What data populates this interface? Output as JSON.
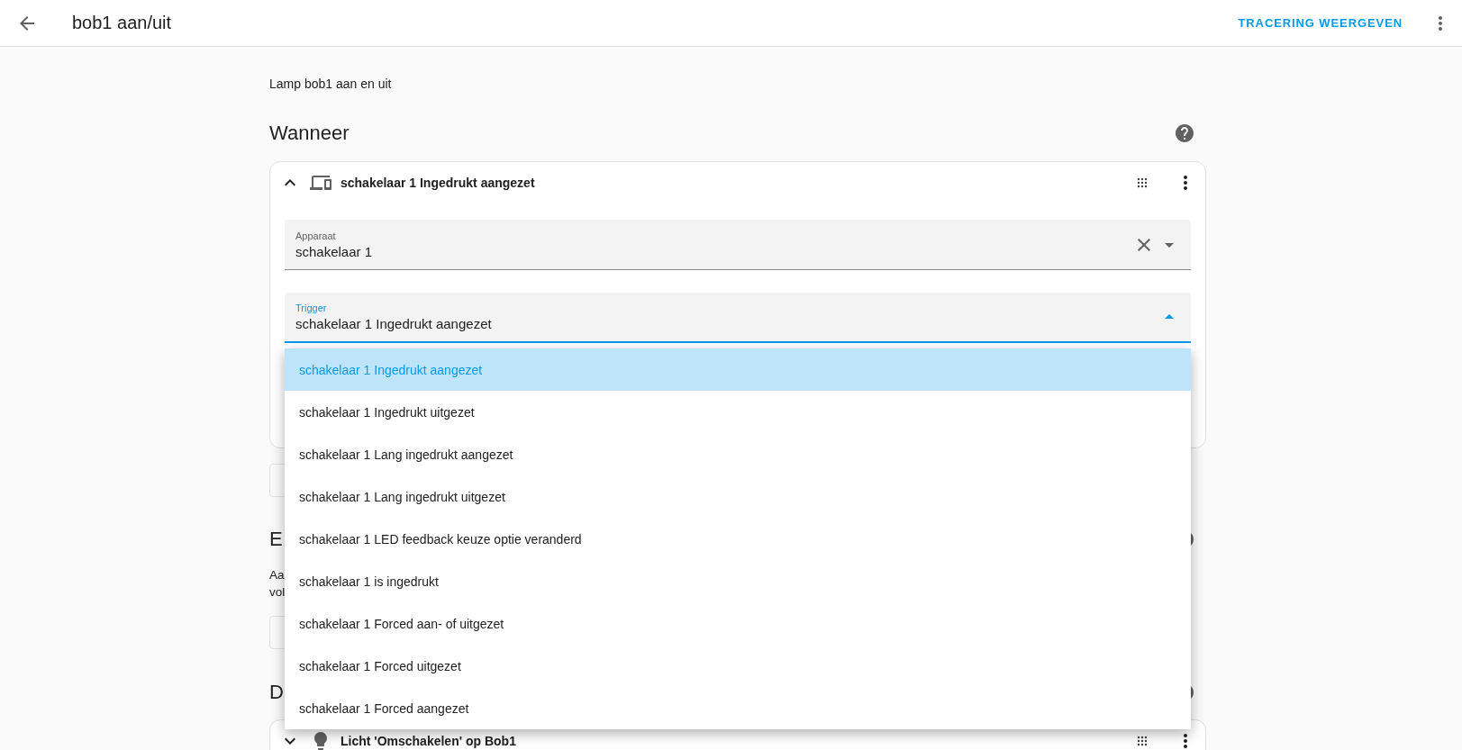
{
  "header": {
    "title": "bob1 aan/uit",
    "action": "TRACERING WEERGEVEN"
  },
  "description": "Lamp bob1 aan en uit",
  "sections": [
    {
      "heading": "Wanneer",
      "cards": [
        {
          "kind": "device",
          "title": "schakelaar 1 Ingedrukt aangezet",
          "expanded": true,
          "fields": [
            {
              "label": "Apparaat",
              "value": "schakelaar 1",
              "clearable": true,
              "open": false
            },
            {
              "label": "Trigger",
              "value": "schakelaar 1 Ingedrukt aangezet",
              "clearable": false,
              "open": true,
              "options": [
                {
                  "label": "schakelaar 1 Ingedrukt aangezet",
                  "selected": true
                },
                {
                  "label": "schakelaar 1 Ingedrukt uitgezet",
                  "selected": false
                },
                {
                  "label": "schakelaar 1 Lang ingedrukt aangezet",
                  "selected": false
                },
                {
                  "label": "schakelaar 1 Lang ingedrukt uitgezet",
                  "selected": false
                },
                {
                  "label": "schakelaar 1 LED feedback keuze optie veranderd",
                  "selected": false
                },
                {
                  "label": "schakelaar 1 is ingedrukt",
                  "selected": false
                },
                {
                  "label": "schakelaar 1 Forced aan- of uitgezet",
                  "selected": false
                },
                {
                  "label": "schakelaar 1 Forced uitgezet",
                  "selected": false
                },
                {
                  "label": "schakelaar 1 Forced aangezet",
                  "selected": false
                }
              ]
            }
          ]
        }
      ]
    },
    {
      "heading": "E",
      "lines": [
        "Aa",
        "vol"
      ]
    },
    {
      "heading": "D",
      "cards": [
        {
          "kind": "light",
          "title": "Licht 'Omschakelen' op Bob1",
          "expanded": false
        }
      ]
    }
  ]
}
